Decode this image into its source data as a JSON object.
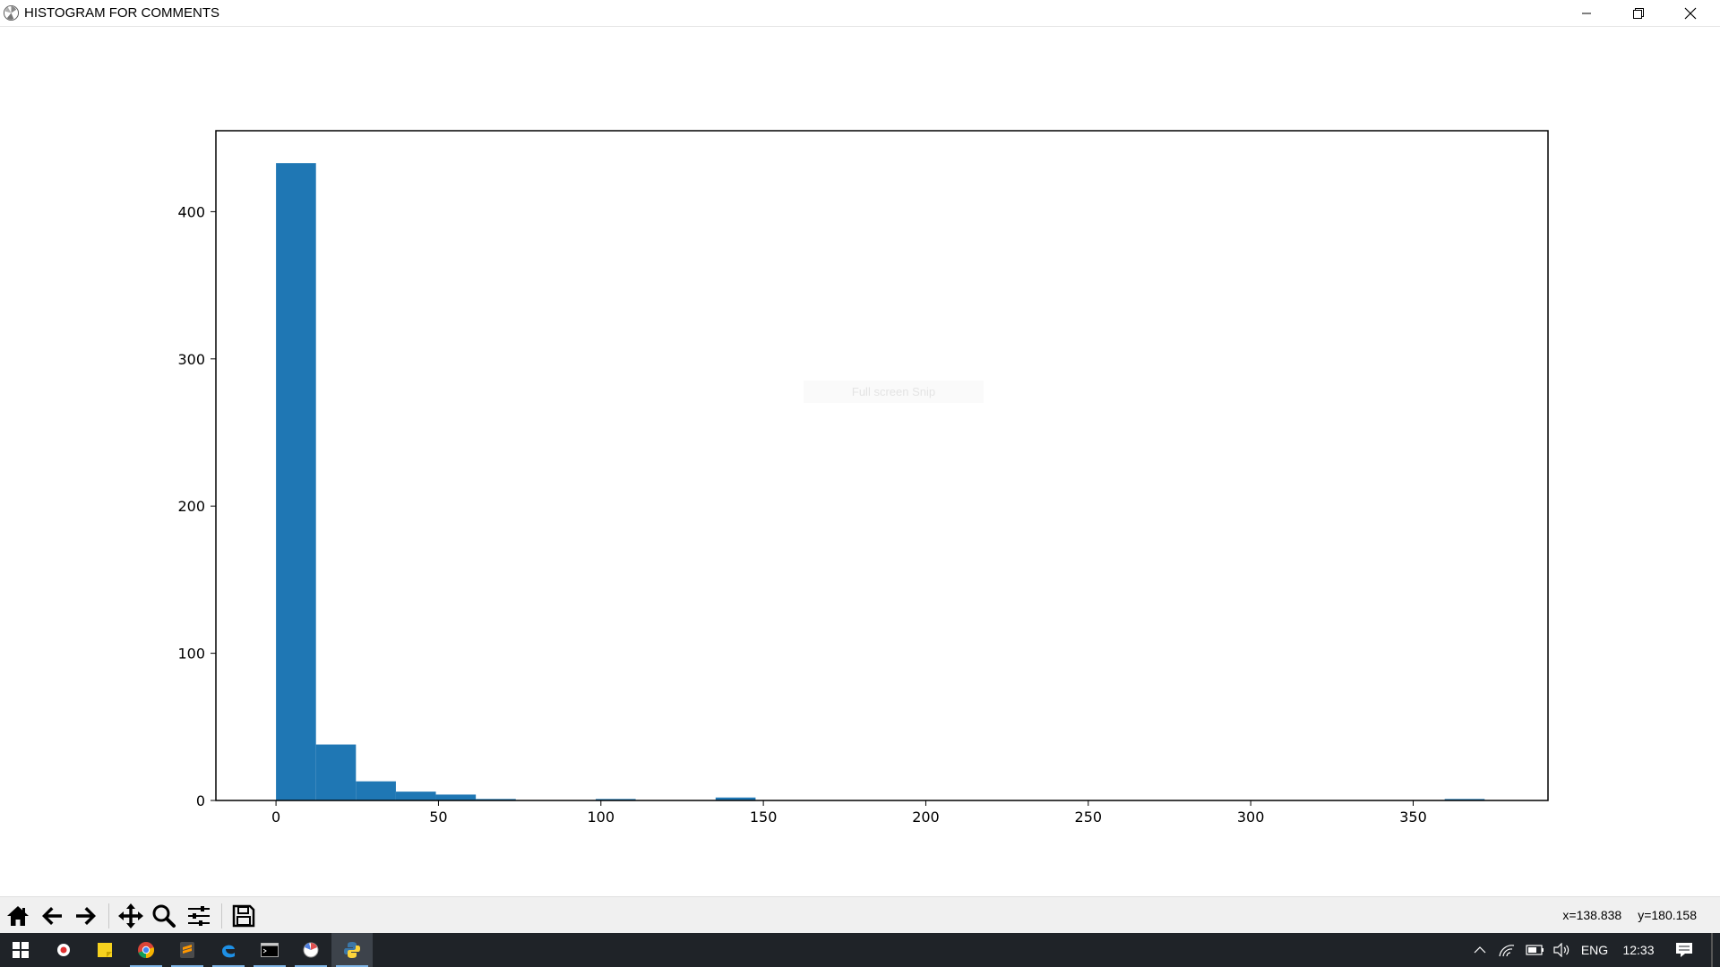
{
  "window": {
    "title": "HISTOGRAM FOR COMMENTS"
  },
  "figure": {
    "ghost_tooltip": "Full screen Snip"
  },
  "chart_data": {
    "type": "bar",
    "title": "",
    "xlabel": "",
    "ylabel": "",
    "xlim": [
      -18.5,
      391.5
    ],
    "ylim": [
      0,
      455
    ],
    "xticks": [
      "0",
      "50",
      "100",
      "150",
      "200",
      "250",
      "300",
      "350"
    ],
    "xtick_values": [
      0,
      50,
      100,
      150,
      200,
      250,
      300,
      350
    ],
    "yticks": [
      "0",
      "100",
      "200",
      "300",
      "400"
    ],
    "ytick_values": [
      0,
      100,
      200,
      300,
      400
    ],
    "bar_color": "#1f77b4",
    "bins": [
      {
        "x0": 0,
        "x1": 12.3,
        "count": 433
      },
      {
        "x0": 12.3,
        "x1": 24.6,
        "count": 38
      },
      {
        "x0": 24.6,
        "x1": 36.9,
        "count": 13
      },
      {
        "x0": 36.9,
        "x1": 49.2,
        "count": 6
      },
      {
        "x0": 49.2,
        "x1": 61.5,
        "count": 4
      },
      {
        "x0": 61.5,
        "x1": 73.8,
        "count": 1
      },
      {
        "x0": 98.4,
        "x1": 110.7,
        "count": 1
      },
      {
        "x0": 135.3,
        "x1": 147.6,
        "count": 2
      },
      {
        "x0": 359.7,
        "x1": 372.0,
        "count": 1
      }
    ]
  },
  "toolbar": {
    "tools": [
      {
        "name": "home-icon"
      },
      {
        "name": "back-arrow-icon"
      },
      {
        "name": "forward-arrow-icon"
      },
      {
        "name": "pan-icon"
      },
      {
        "name": "zoom-icon"
      },
      {
        "name": "configure-subplots-icon"
      },
      {
        "name": "save-icon"
      }
    ],
    "x_readout": "x=138.838",
    "y_readout": "y=180.158"
  },
  "taskbar": {
    "language": "ENG",
    "clock": "12:33"
  }
}
